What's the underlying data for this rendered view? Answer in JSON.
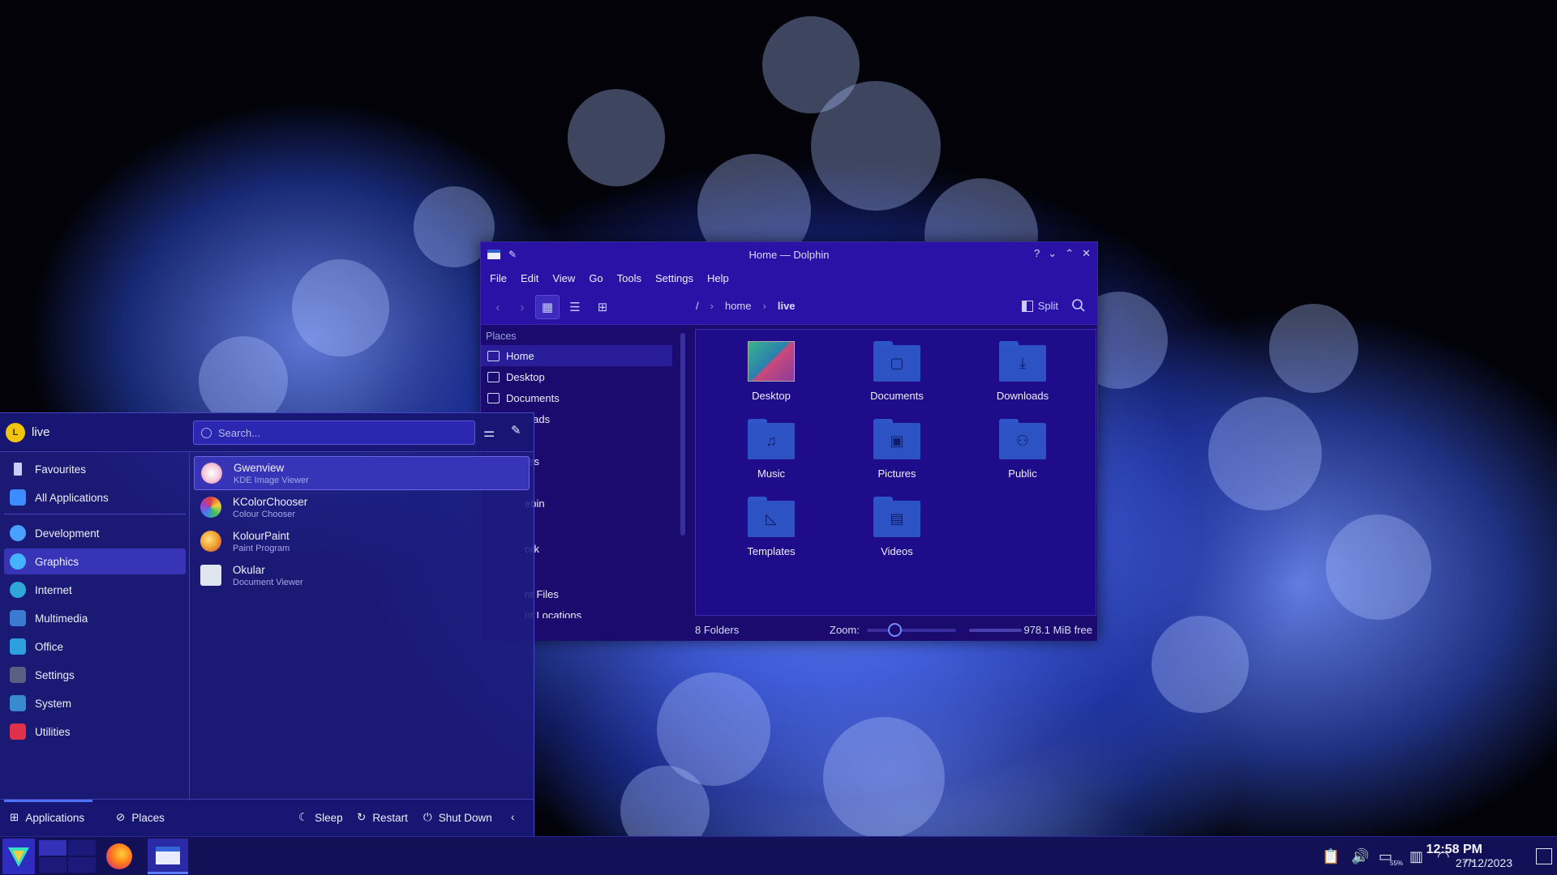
{
  "dolphin": {
    "title": "Home — Dolphin",
    "menu": [
      "File",
      "Edit",
      "View",
      "Go",
      "Tools",
      "Settings",
      "Help"
    ],
    "breadcrumb": [
      "/",
      "home",
      "live"
    ],
    "split_label": "Split",
    "places_header": "Places",
    "places": [
      "Home",
      "Desktop",
      "Documents",
      "loads",
      "",
      "res",
      "s",
      "ebin",
      "ork",
      "nt Files",
      "nt Locations"
    ],
    "folders": [
      {
        "name": "Desktop",
        "icon": "desktop-thumb"
      },
      {
        "name": "Documents",
        "icon": "document-folder-icon"
      },
      {
        "name": "Downloads",
        "icon": "download-folder-icon"
      },
      {
        "name": "Music",
        "icon": "music-folder-icon"
      },
      {
        "name": "Pictures",
        "icon": "pictures-folder-icon"
      },
      {
        "name": "Public",
        "icon": "public-folder-icon"
      },
      {
        "name": "Templates",
        "icon": "templates-folder-icon"
      },
      {
        "name": "Videos",
        "icon": "videos-folder-icon"
      }
    ],
    "status_left": "8 Folders",
    "zoom_label": "Zoom:",
    "free_space": "978.1 MiB free"
  },
  "kickoff": {
    "user": "live",
    "avatar_letter": "L",
    "search_placeholder": "Search...",
    "categories": [
      {
        "label": "Favourites",
        "color": "#c9ccff"
      },
      {
        "label": "All Applications",
        "color": "#3d8cff"
      },
      {
        "label": "Development",
        "color": "#4aa0ff"
      },
      {
        "label": "Graphics",
        "color": "#45b3ff"
      },
      {
        "label": "Internet",
        "color": "#2fa8d8"
      },
      {
        "label": "Multimedia",
        "color": "#3a7ad0"
      },
      {
        "label": "Office",
        "color": "#2ea0e0"
      },
      {
        "label": "Settings",
        "color": "#5a6080"
      },
      {
        "label": "System",
        "color": "#3a8ad0"
      },
      {
        "label": "Utilities",
        "color": "#e0304a"
      }
    ],
    "apps": [
      {
        "name": "Gwenview",
        "desc": "KDE Image Viewer",
        "color": "#f0d0e0"
      },
      {
        "name": "KColorChooser",
        "desc": "Colour Chooser",
        "color": "#e04040"
      },
      {
        "name": "KolourPaint",
        "desc": "Paint Program",
        "color": "#f0a030"
      },
      {
        "name": "Okular",
        "desc": "Document Viewer",
        "color": "#e0e6f0"
      }
    ],
    "footer": {
      "applications": "Applications",
      "places": "Places",
      "sleep": "Sleep",
      "restart": "Restart",
      "shutdown": "Shut Down"
    }
  },
  "taskbar": {
    "time": "12:58 PM",
    "date": "27/12/2023",
    "battery_label": "55%"
  }
}
